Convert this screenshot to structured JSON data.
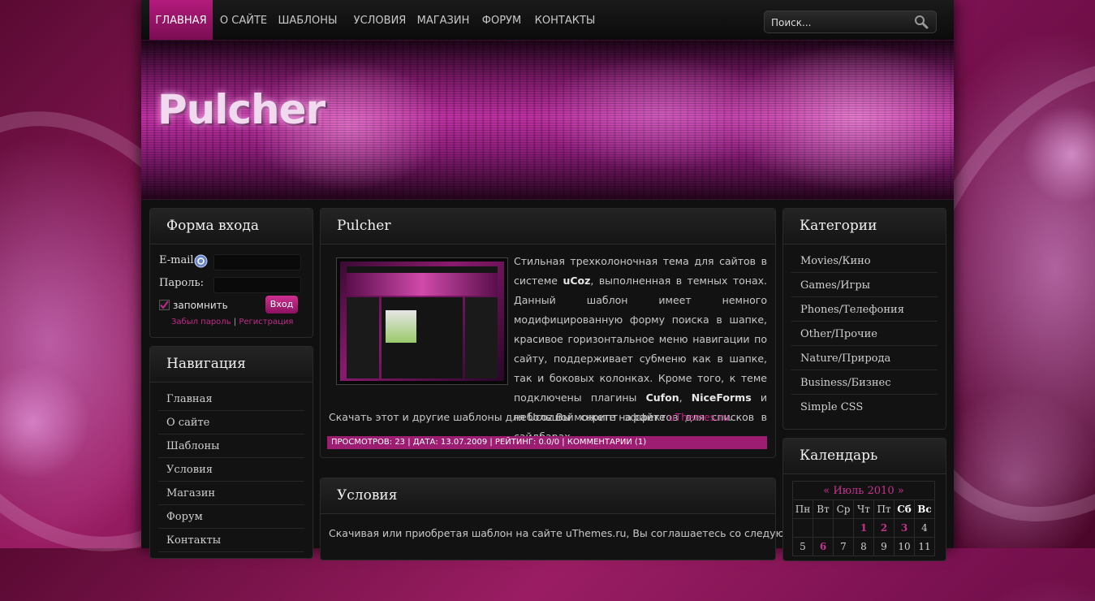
{
  "colors": {
    "accent": "#b41a7c",
    "link": "#c02a8a",
    "meta_bar": "#9c1d72"
  },
  "nav": {
    "items": [
      "ГЛАВНАЯ",
      "О САЙТЕ",
      "ШАБЛОНЫ",
      "УСЛОВИЯ",
      "МАГАЗИН",
      "ФОРУМ",
      "КОНТАКТЫ"
    ],
    "active_index": 0
  },
  "search": {
    "placeholder": "Поиск...",
    "icon": "magnifier-icon"
  },
  "header": {
    "logo": "Pulcher"
  },
  "login": {
    "title": "Форма входа",
    "email_label": "E-mail:",
    "openid_icon": "openid-icon",
    "password_label": "Пароль:",
    "remember_label": "запомнить",
    "remember_checked": true,
    "submit_label": "Вход",
    "forgot_link": "Забыл пароль",
    "separator": "|",
    "register_link": "Регистрация"
  },
  "navigation": {
    "title": "Навигация",
    "items": [
      "Главная",
      "О сайте",
      "Шаблоны",
      "Условия",
      "Магазин",
      "Форум",
      "Контакты"
    ]
  },
  "post1": {
    "title": "Pulcher",
    "p1_a": "Стильная трехколоночная тема для сайтов в системе ",
    "p1_ucoz": "uCoz",
    "p1_b": ", выполненная в темных тонах. Данный шаблон имеет немного модифицированную форму поиска в шапке, красивое горизонтальное меню навигации по сайту, поддерживает субменю как в шапке, так и боковых колонках. Кроме того, к теме подключены плагины ",
    "p1_cufon": "Cufon",
    "p1_comma": ", ",
    "p1_niceforms": "NiceForms",
    "p1_c": " и небольшой скрипт эффектов для списков в сайдбарах.",
    "p2_a": "Скачать этот и другие шаблоны для Ucoz Вы можете на сайте ",
    "p2_link": "uThemes.ru",
    "p2_b": ".",
    "meta": "ПРОСМОТРОВ: 23 | ДАТА: 13.07.2009 | РЕЙТИНГ: 0.0/0 | КОММЕНТАРИИ (1)"
  },
  "post2": {
    "title": "Условия",
    "text": "Скачивая или приобретая шаблон на сайте uThemes.ru, Вы соглашаетесь со следующими"
  },
  "categories": {
    "title": "Категории",
    "items": [
      "Movies/Кино",
      "Games/Игры",
      "Phones/Телефония",
      "Other/Прочие",
      "Nature/Природа",
      "Business/Бизнес",
      "Simple CSS"
    ]
  },
  "calendar": {
    "title": "Календарь",
    "prev": "«",
    "month": "Июль 2010",
    "next": "»",
    "weekdays": [
      "Пн",
      "Вт",
      "Ср",
      "Чт",
      "Пт",
      "Сб",
      "Вс"
    ],
    "row1": [
      "",
      "",
      "",
      "1",
      "2",
      "3",
      "4"
    ],
    "row2": [
      "5",
      "6",
      "7",
      "8",
      "9",
      "10",
      "11"
    ]
  }
}
